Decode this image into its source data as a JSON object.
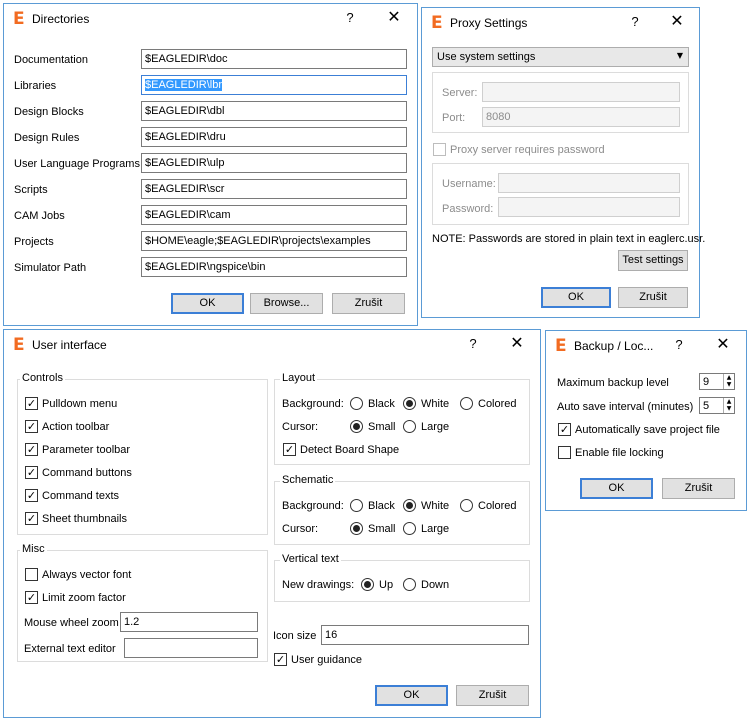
{
  "directories": {
    "title": "Directories",
    "help": "?",
    "close": "✕",
    "rows": [
      {
        "label": "Documentation",
        "value": "$EAGLEDIR\\doc"
      },
      {
        "label": "Libraries",
        "value": "$EAGLEDIR\\lbr"
      },
      {
        "label": "Design Blocks",
        "value": "$EAGLEDIR\\dbl"
      },
      {
        "label": "Design Rules",
        "value": "$EAGLEDIR\\dru"
      },
      {
        "label": "User Language Programs",
        "value": "$EAGLEDIR\\ulp"
      },
      {
        "label": "Scripts",
        "value": "$EAGLEDIR\\scr"
      },
      {
        "label": "CAM Jobs",
        "value": "$EAGLEDIR\\cam"
      },
      {
        "label": "Projects",
        "value": "$HOME\\eagle;$EAGLEDIR\\projects\\examples"
      },
      {
        "label": "Simulator Path",
        "value": "$EAGLEDIR\\ngspice\\bin"
      }
    ],
    "ok": "OK",
    "browse": "Browse...",
    "cancel": "Zrušit"
  },
  "proxy": {
    "title": "Proxy Settings",
    "help": "?",
    "close": "✕",
    "mode": "Use system settings",
    "server_label": "Server:",
    "server_value": "",
    "port_label": "Port:",
    "port_value": "8080",
    "requires_password": "Proxy server requires password",
    "username_label": "Username:",
    "password_label": "Password:",
    "note": "NOTE: Passwords are stored in plain text in eaglerc.usr.",
    "test": "Test settings",
    "ok": "OK",
    "cancel": "Zrušit"
  },
  "ui": {
    "title": "User interface",
    "help": "?",
    "close": "✕",
    "controls": {
      "title": "Controls",
      "items": [
        {
          "label": "Pulldown menu",
          "checked": true
        },
        {
          "label": "Action toolbar",
          "checked": true
        },
        {
          "label": "Parameter toolbar",
          "checked": true
        },
        {
          "label": "Command buttons",
          "checked": true
        },
        {
          "label": "Command texts",
          "checked": true
        },
        {
          "label": "Sheet thumbnails",
          "checked": true
        }
      ]
    },
    "misc": {
      "title": "Misc",
      "always_vector": "Always vector font",
      "limit_zoom": "Limit zoom factor",
      "wheel_label": "Mouse wheel zoom",
      "wheel_value": "1.2",
      "editor_label": "External text editor",
      "editor_value": ""
    },
    "layout": {
      "title": "Layout",
      "bg_label": "Background:",
      "cursor_label": "Cursor:",
      "black": "Black",
      "white": "White",
      "colored": "Colored",
      "small": "Small",
      "large": "Large",
      "detect": "Detect Board Shape"
    },
    "schematic": {
      "title": "Schematic",
      "bg_label": "Background:",
      "cursor_label": "Cursor:",
      "black": "Black",
      "white": "White",
      "colored": "Colored",
      "small": "Small",
      "large": "Large"
    },
    "vertical": {
      "title": "Vertical text",
      "label": "New drawings:",
      "up": "Up",
      "down": "Down"
    },
    "icon_size_label": "Icon size",
    "icon_size_value": "16",
    "user_guidance": "User guidance",
    "ok": "OK",
    "cancel": "Zrušit"
  },
  "backup": {
    "title": "Backup / Loc...",
    "help": "?",
    "close": "✕",
    "max_label": "Maximum backup level",
    "max_value": "9",
    "auto_label": "Auto save interval (minutes)",
    "auto_value": "5",
    "auto_project": "Automatically save project file",
    "file_locking": "Enable file locking",
    "ok": "OK",
    "cancel": "Zrušit"
  },
  "icons": {
    "app": "eagle-logo-icon",
    "check": "✓",
    "spin_up": "▲",
    "spin_down": "▼",
    "dropdown": "▼"
  },
  "colors": {
    "accent": "#3c7fd6",
    "logo": "#f26b21",
    "border": "#5b9bd5"
  }
}
